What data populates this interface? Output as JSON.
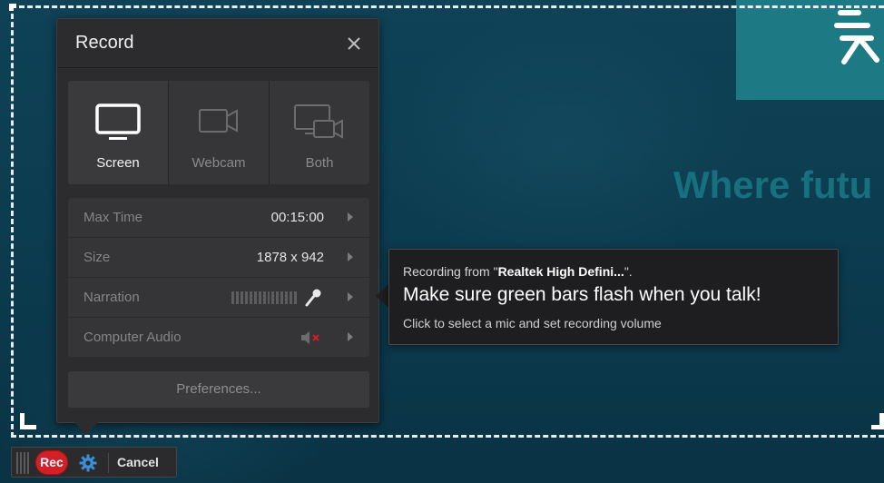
{
  "background": {
    "slide_text": "Where futu",
    "accent_color": "#1d7a84"
  },
  "panel": {
    "title": "Record",
    "close_icon": "close-icon",
    "modes": [
      {
        "label": "Screen",
        "icon": "monitor-icon",
        "active": true
      },
      {
        "label": "Webcam",
        "icon": "webcam-icon",
        "active": false
      },
      {
        "label": "Both",
        "icon": "screen-webcam-icon",
        "active": false
      }
    ],
    "settings": [
      {
        "label": "Max Time",
        "value": "00:15:00"
      },
      {
        "label": "Size",
        "value": "1878 x 942"
      },
      {
        "label": "Narration",
        "value": ""
      },
      {
        "label": "Computer Audio",
        "value": ""
      }
    ],
    "preferences_label": "Preferences..."
  },
  "tooltip": {
    "line1_prefix": "Recording from \"",
    "line1_device": "Realtek High Defini...",
    "line1_suffix": "\".",
    "line2": "Make sure green bars flash when you talk!",
    "line3": "Click to select a mic and set recording volume"
  },
  "toolbar": {
    "rec_label": "Rec",
    "cancel_label": "Cancel",
    "rec_color": "#d32027"
  }
}
